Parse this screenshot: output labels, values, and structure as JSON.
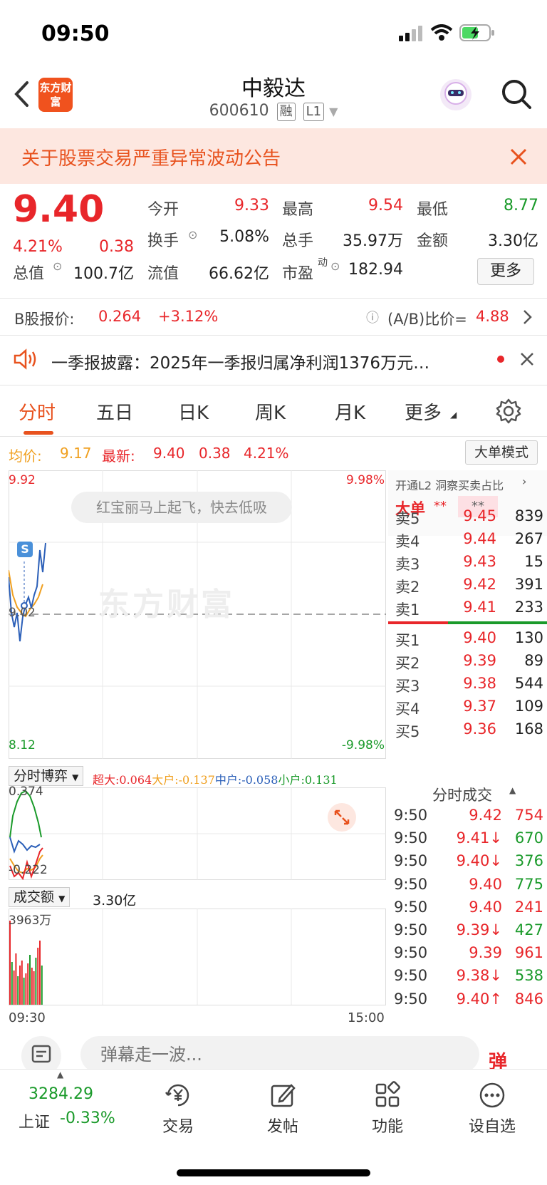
{
  "status": {
    "time": "09:50"
  },
  "header": {
    "logo": "东方财富",
    "stock_name": "中毅达",
    "stock_code": "600610",
    "tag_margin": "融",
    "tag_level": "L1"
  },
  "notice": {
    "text": "关于股票交易严重异常波动公告"
  },
  "quote": {
    "price": "9.40",
    "change_pct": "4.21%",
    "change_amt": "0.38",
    "open_label": "今开",
    "open": "9.33",
    "high_label": "最高",
    "high": "9.54",
    "low_label": "最低",
    "low": "8.77",
    "turnover_label": "换手",
    "turnover": "5.08%",
    "volume_label": "总手",
    "volume": "35.97万",
    "amount_label": "金额",
    "amount": "3.30亿",
    "mktcap_label": "总值",
    "mktcap": "100.7亿",
    "float_label": "流值",
    "float_cap": "66.62亿",
    "pe_label": "市盈",
    "pe_sup": "动",
    "pe": "182.94",
    "more_label": "更多"
  },
  "b_share": {
    "label": "B股报价:",
    "price": "0.264",
    "change": "+3.12%",
    "ratio_label": "(A/B)比价=",
    "ratio": "4.88"
  },
  "report": {
    "text": "一季报披露：2025年一季报归属净利润1376万元…"
  },
  "tabs": [
    "分时",
    "五日",
    "日K",
    "周K",
    "月K",
    "更多"
  ],
  "info_row": {
    "avg_label": "均价:",
    "avg": "9.17",
    "latest_label": "最新:",
    "latest": "9.40",
    "latest_chg": "0.38",
    "latest_pct": "4.21%",
    "bigorder_label": "大单模式"
  },
  "chart": {
    "y_top": "9.92",
    "y_top_pct": "9.98%",
    "y_mid": "9.02",
    "y_bottom": "8.12",
    "y_bottom_pct": "-9.98%",
    "bubble": "红宝丽马上起飞，快去低吸",
    "watermark": "东方财富",
    "s_marker": "S"
  },
  "game": {
    "dropdown": "分时博弈",
    "super_label": "超大:",
    "super": "0.064",
    "big_label": "大户:",
    "big": "-0.137",
    "mid_label": "中户:",
    "mid": "-0.058",
    "small_label": "小户:",
    "small": "0.131",
    "y_top": "0.374",
    "y_bottom": "-0.222"
  },
  "volume": {
    "dropdown": "成交额",
    "total": "3.30亿",
    "y_top": "3963万",
    "x_start": "09:30",
    "x_end": "15:00"
  },
  "orderbook": {
    "l2_label": "开通L2 洞察买卖占比",
    "big_label": "大单",
    "big_stars": "**",
    "big_stars_box": "**",
    "sells": [
      {
        "label": "卖5",
        "price": "9.45",
        "vol": "839"
      },
      {
        "label": "卖4",
        "price": "9.44",
        "vol": "267"
      },
      {
        "label": "卖3",
        "price": "9.43",
        "vol": "15"
      },
      {
        "label": "卖2",
        "price": "9.42",
        "vol": "391"
      },
      {
        "label": "卖1",
        "price": "9.41",
        "vol": "233"
      }
    ],
    "buys": [
      {
        "label": "买1",
        "price": "9.40",
        "vol": "130"
      },
      {
        "label": "买2",
        "price": "9.39",
        "vol": "89"
      },
      {
        "label": "买3",
        "price": "9.38",
        "vol": "544"
      },
      {
        "label": "买4",
        "price": "9.37",
        "vol": "109"
      },
      {
        "label": "买5",
        "price": "9.36",
        "vol": "168"
      }
    ]
  },
  "ticks": {
    "title": "分时成交",
    "rows": [
      {
        "time": "9:50",
        "price": "9.42",
        "vol": "754",
        "pc": "red",
        "vc": "red"
      },
      {
        "time": "9:50",
        "price": "9.41↓",
        "vol": "670",
        "pc": "red",
        "vc": "green"
      },
      {
        "time": "9:50",
        "price": "9.40↓",
        "vol": "376",
        "pc": "red",
        "vc": "green"
      },
      {
        "time": "9:50",
        "price": "9.40",
        "vol": "775",
        "pc": "red",
        "vc": "green"
      },
      {
        "time": "9:50",
        "price": "9.40",
        "vol": "241",
        "pc": "red",
        "vc": "red"
      },
      {
        "time": "9:50",
        "price": "9.39↓",
        "vol": "427",
        "pc": "red",
        "vc": "green"
      },
      {
        "time": "9:50",
        "price": "9.39",
        "vol": "961",
        "pc": "red",
        "vc": "red"
      },
      {
        "time": "9:50",
        "price": "9.38↓",
        "vol": "538",
        "pc": "red",
        "vc": "green"
      },
      {
        "time": "9:50",
        "price": "9.40↑",
        "vol": "846",
        "pc": "red",
        "vc": "red"
      }
    ]
  },
  "danmaku": {
    "placeholder": "弹幕走一波...",
    "button": "弹"
  },
  "bottom_nav": {
    "index_value": "3284.29",
    "index_name": "上证",
    "index_change": "-0.33%",
    "items": [
      "交易",
      "发帖",
      "功能",
      "设自选"
    ]
  },
  "colors": {
    "up": "#e8262a",
    "down": "#1a9a2a",
    "accent": "#e8521e",
    "avg_line": "#f0a020",
    "price_line": "#2b5fb8"
  }
}
